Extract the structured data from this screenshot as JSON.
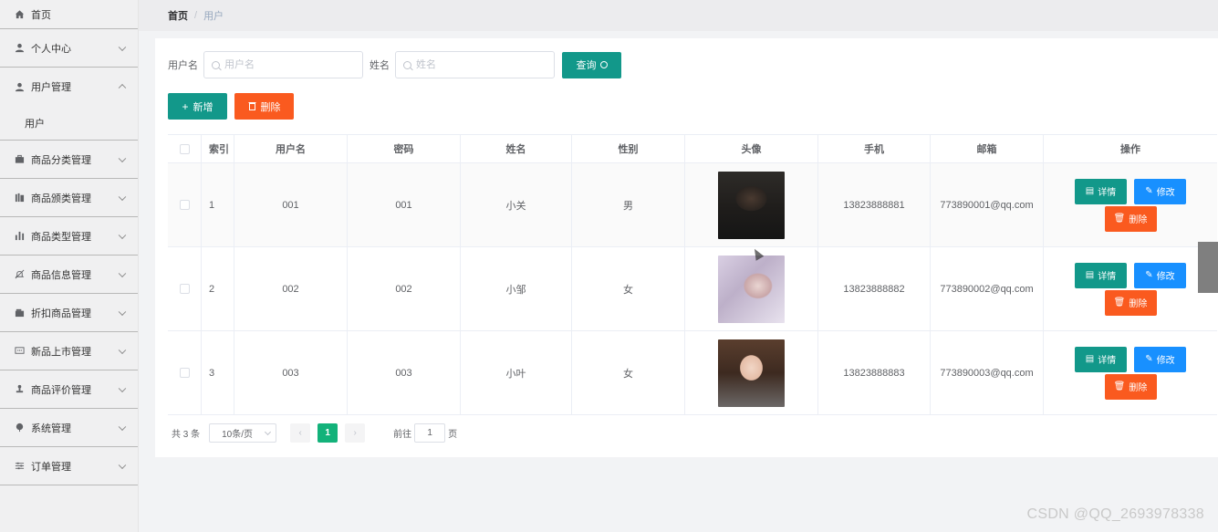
{
  "sidebar": {
    "items": [
      {
        "label": "首页",
        "icon": "home-icon"
      },
      {
        "label": "个人中心",
        "icon": "user-icon"
      },
      {
        "label": "用户管理",
        "icon": "user-icon",
        "sub": [
          "用户"
        ]
      },
      {
        "label": "商品分类管理",
        "icon": "briefcase-icon"
      },
      {
        "label": "商品颁类管理",
        "icon": "library-icon"
      },
      {
        "label": "商品类型管理",
        "icon": "bar-chart-icon"
      },
      {
        "label": "商品信息管理",
        "icon": "bell-off-icon"
      },
      {
        "label": "折扣商品管理",
        "icon": "wallet-icon"
      },
      {
        "label": "新品上市管理",
        "icon": "message-icon"
      },
      {
        "label": "商品评价管理",
        "icon": "stamp-icon"
      },
      {
        "label": "系统管理",
        "icon": "flower-icon"
      },
      {
        "label": "订单管理",
        "icon": "sliders-icon"
      }
    ]
  },
  "breadcrumb": {
    "home": "首页",
    "separator": "/",
    "current": "用户"
  },
  "search": {
    "username_label": "用户名",
    "username_placeholder": "用户名",
    "name_label": "姓名",
    "name_placeholder": "姓名",
    "query_label": "查询"
  },
  "actions": {
    "add_label": "新增",
    "delete_label": "删除"
  },
  "table": {
    "headers": [
      "索引",
      "用户名",
      "密码",
      "姓名",
      "性别",
      "头像",
      "手机",
      "邮箱",
      "操作"
    ],
    "rows": [
      {
        "index": "1",
        "username": "001",
        "password": "001",
        "name": "小关",
        "sex": "男",
        "phone": "13823888881",
        "email": "773890001@qq.com"
      },
      {
        "index": "2",
        "username": "002",
        "password": "002",
        "name": "小邹",
        "sex": "女",
        "phone": "13823888882",
        "email": "773890002@qq.com"
      },
      {
        "index": "3",
        "username": "003",
        "password": "003",
        "name": "小叶",
        "sex": "女",
        "phone": "13823888883",
        "email": "773890003@qq.com"
      }
    ],
    "op_detail": "详情",
    "op_edit": "修改",
    "op_delete": "删除"
  },
  "pager": {
    "total": "共 3 条",
    "page_size": "10条/页",
    "current_page": "1",
    "goto_label": "前往",
    "goto_value": "1",
    "page_suffix": "页"
  },
  "watermark": "CSDN @QQ_2693978338",
  "colors": {
    "primary": "#12988a",
    "danger": "#fa5a1f",
    "info": "#1890ff",
    "pager_active": "#13b27a"
  }
}
